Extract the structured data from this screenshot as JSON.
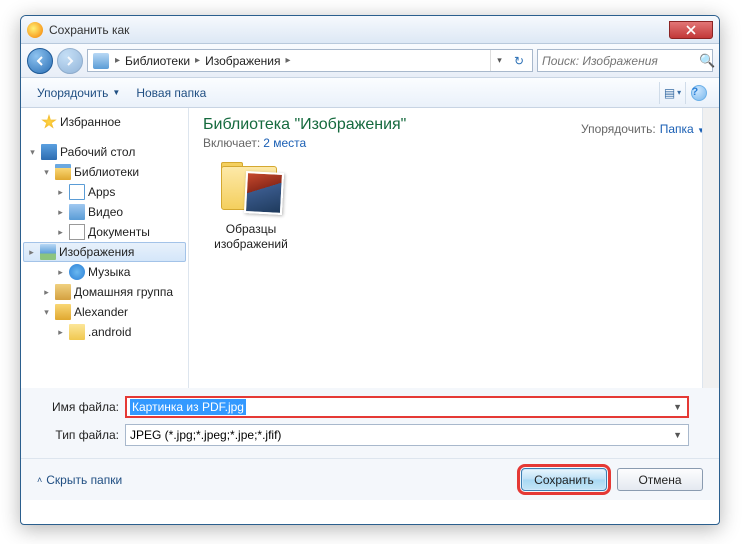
{
  "window": {
    "title": "Сохранить как"
  },
  "nav": {
    "breadcrumb": [
      "Библиотеки",
      "Изображения"
    ],
    "search_placeholder": "Поиск: Изображения"
  },
  "toolbar": {
    "organize": "Упорядочить",
    "newfolder": "Новая папка"
  },
  "sidebar": {
    "items": [
      {
        "label": "Избранное",
        "icon": "i-fav",
        "indent": 1,
        "exp": ""
      },
      {
        "label": "",
        "spacer": true
      },
      {
        "label": "Рабочий стол",
        "icon": "i-desk",
        "indent": 1,
        "exp": "▾"
      },
      {
        "label": "Библиотеки",
        "icon": "i-lib",
        "indent": 2,
        "exp": "▾"
      },
      {
        "label": "Apps",
        "icon": "i-app",
        "indent": 3,
        "exp": "▸"
      },
      {
        "label": "Видео",
        "icon": "i-vid",
        "indent": 3,
        "exp": "▸"
      },
      {
        "label": "Документы",
        "icon": "i-doc",
        "indent": 3,
        "exp": "▸"
      },
      {
        "label": "Изображения",
        "icon": "i-img",
        "indent": 3,
        "exp": "▸",
        "selected": true
      },
      {
        "label": "Музыка",
        "icon": "i-mus",
        "indent": 3,
        "exp": "▸"
      },
      {
        "label": "Домашняя группа",
        "icon": "i-home",
        "indent": 2,
        "exp": "▸"
      },
      {
        "label": "Alexander",
        "icon": "i-user",
        "indent": 2,
        "exp": "▾"
      },
      {
        "label": ".android",
        "icon": "i-fold",
        "indent": 3,
        "exp": "▸"
      }
    ]
  },
  "content": {
    "library_title": "Библиотека \"Изображения\"",
    "includes_label": "Включает:",
    "includes_count": "2 места",
    "arrange_label": "Упорядочить:",
    "arrange_value": "Папка",
    "items": [
      {
        "name": "Образцы изображений"
      }
    ]
  },
  "fields": {
    "filename_label": "Имя файла:",
    "filename_value": "Картинка из PDF.jpg",
    "filetype_label": "Тип файла:",
    "filetype_value": "JPEG (*.jpg;*.jpeg;*.jpe;*.jfif)"
  },
  "footer": {
    "hide_folders": "Скрыть папки",
    "save": "Сохранить",
    "cancel": "Отмена"
  }
}
